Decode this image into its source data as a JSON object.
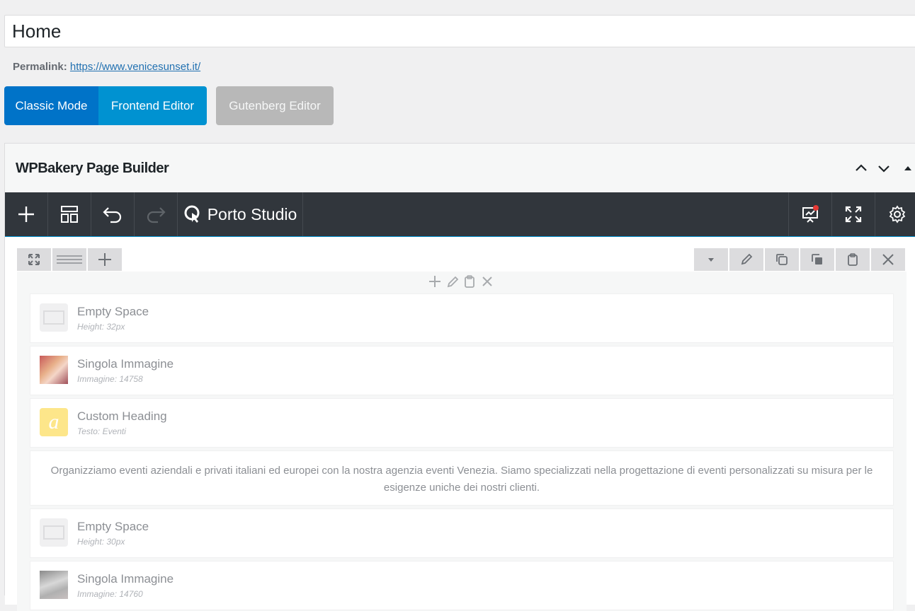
{
  "post": {
    "title": "Home",
    "permalink_label": "Permalink:",
    "permalink_url": "https://www.venicesunset.it/"
  },
  "modes": {
    "classic": "Classic Mode",
    "frontend": "Frontend Editor",
    "gutenberg": "Gutenberg Editor"
  },
  "builder": {
    "title": "WPBakery Page Builder",
    "toolbar": {
      "porto_studio": "Porto Studio"
    }
  },
  "elements": [
    {
      "name": "Empty Space",
      "meta": "Height: 32px",
      "icon": "empty-space-icon"
    },
    {
      "name": "Singola Immagine",
      "meta": "Immagine: 14758",
      "icon": "image-thumbnail-icon"
    },
    {
      "name": "Custom Heading",
      "meta": "Testo: Eventi",
      "icon": "heading-a-icon"
    },
    {
      "text": "Organizziamo eventi aziendali e privati italiani ed europei con la nostra agenzia eventi Venezia. Siamo specializzati nella progettazione di eventi personalizzati su misura per le esigenze uniche dei nostri clienti."
    },
    {
      "name": "Empty Space",
      "meta": "Height: 30px",
      "icon": "empty-space-icon"
    },
    {
      "name": "Singola Immagine",
      "meta": "Immagine: 14760",
      "icon": "image-thumbnail-icon"
    }
  ],
  "colors": {
    "accent_blue": "#0073c8",
    "frontend_blue": "#0092d1",
    "toolbar_dark": "#31363c",
    "notification_red": "#e53935",
    "heading_yellow": "#fde68a"
  }
}
